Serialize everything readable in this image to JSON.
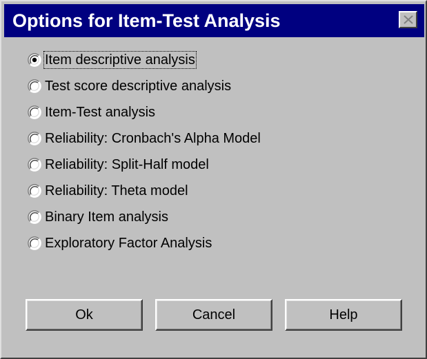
{
  "dialog": {
    "title": "Options for Item-Test Analysis",
    "colors": {
      "titlebar": "#000080",
      "title_text": "#ffffff",
      "face": "#c0c0c0"
    },
    "close_icon": "close-icon"
  },
  "options": {
    "selected_index": 0,
    "items": [
      {
        "label": "Item descriptive analysis",
        "selected": true
      },
      {
        "label": "Test score descriptive analysis",
        "selected": false
      },
      {
        "label": "Item-Test analysis",
        "selected": false
      },
      {
        "label": "Reliability: Cronbach's Alpha Model",
        "selected": false
      },
      {
        "label": "Reliability: Split-Half model",
        "selected": false
      },
      {
        "label": "Reliability: Theta model",
        "selected": false
      },
      {
        "label": "Binary Item analysis",
        "selected": false
      },
      {
        "label": "Exploratory Factor Analysis",
        "selected": false
      }
    ]
  },
  "buttons": {
    "ok_label": "Ok",
    "cancel_label": "Cancel",
    "help_label": "Help"
  }
}
